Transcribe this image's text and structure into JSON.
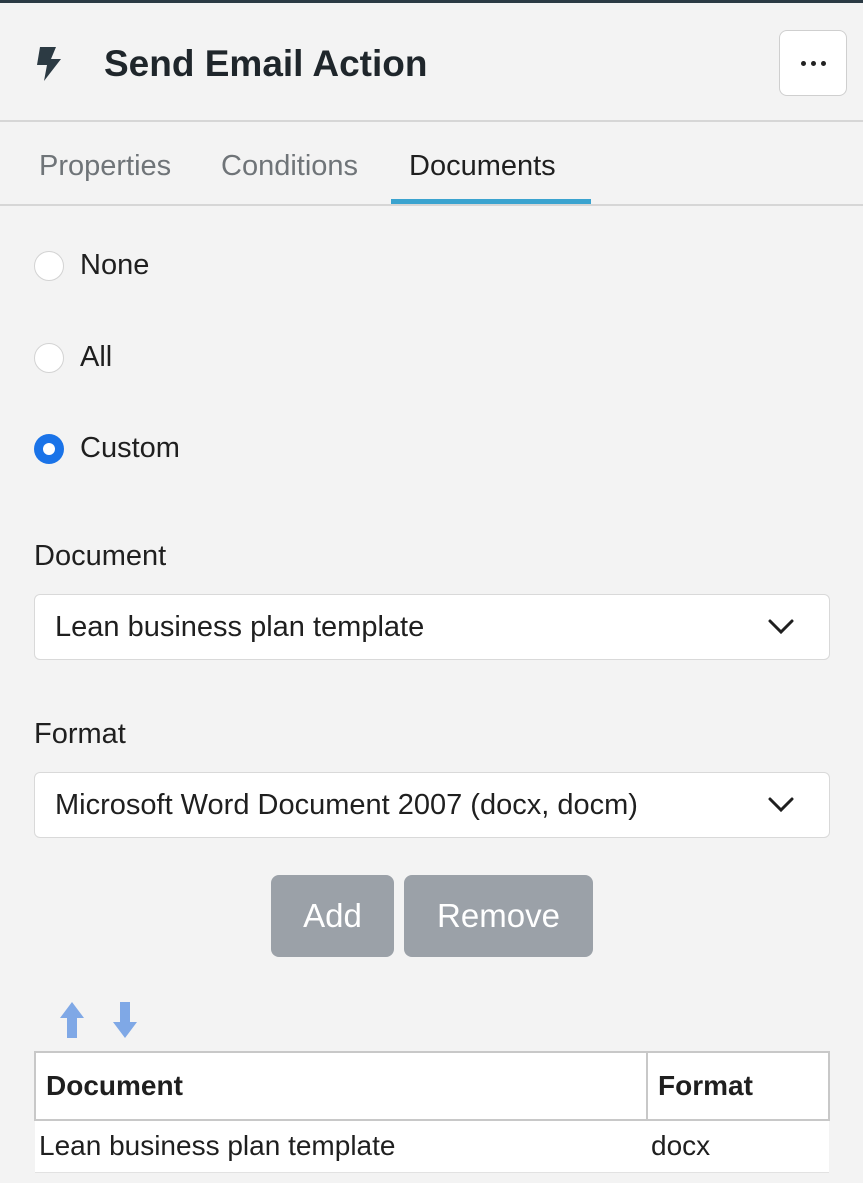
{
  "header": {
    "title": "Send Email Action",
    "icon": "bolt-icon",
    "more_icon": "ellipsis-icon"
  },
  "tabs": [
    {
      "label": "Properties",
      "active": false
    },
    {
      "label": "Conditions",
      "active": false
    },
    {
      "label": "Documents",
      "active": true
    }
  ],
  "radio_options": [
    {
      "label": "None",
      "checked": false
    },
    {
      "label": "All",
      "checked": false
    },
    {
      "label": "Custom",
      "checked": true
    }
  ],
  "document_field": {
    "label": "Document",
    "value": "Lean business plan template"
  },
  "format_field": {
    "label": "Format",
    "value": "Microsoft Word Document 2007 (docx, docm)"
  },
  "buttons": {
    "add": "Add",
    "remove": "Remove"
  },
  "table": {
    "columns": [
      "Document",
      "Format"
    ],
    "rows": [
      {
        "document": "Lean business plan template",
        "format": "docx"
      }
    ]
  },
  "colors": {
    "accent": "#3aa3cf",
    "radio_checked": "#1a73e8",
    "button_bg": "#9ba1a8"
  }
}
